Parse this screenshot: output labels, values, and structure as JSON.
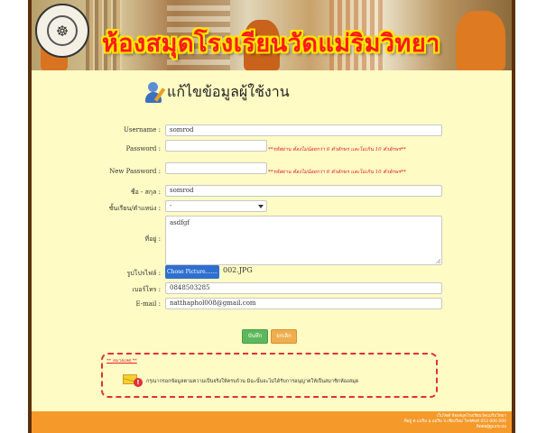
{
  "banner": {
    "title": "ห้องสมุดโรงเรียนวัดแม่ริมวิทยา"
  },
  "page": {
    "heading": "แก้ไขข้อมูลผู้ใช้งาน"
  },
  "form": {
    "username_label": "Username :",
    "username_value": "somrod",
    "password_label": "Password :",
    "password_value": "",
    "password_hint": "**รหัสผ่าน ต้องไม่น้อยกว่า 6 ตัวอักษร และไม่เกิน 10 ตัวอักษร**",
    "new_password_label": "New Password :",
    "new_password_value": "",
    "new_password_hint": "**รหัสผ่าน ต้องไม่น้อยกว่า 6 ตัวอักษร และไม่เกิน 10 ตัวอักษร**",
    "name_label": "ชื่อ - สกุล :",
    "name_value": "somrod",
    "class_label": "ชั้นเรียน/ตำแหน่ง :",
    "class_value": "-",
    "address_label": "ที่อยู่ :",
    "address_value": "asdfgf",
    "photo_label": "รูปโปรไฟล์ :",
    "photo_button": "Chose Picture.......",
    "photo_filename": "002.JPG",
    "phone_label": "เบอร์โทร :",
    "phone_value": "0848503285",
    "email_label": "E-mail :",
    "email_value": "natthaphol008@gmail.com",
    "save_button": "บันทึก",
    "cancel_button": "ยกเลิก"
  },
  "notice": {
    "label": "** หมายเหตุ **",
    "text": "กรุณากรอกข้อมูลตามความเป็นจริงให้ครบถ้วน มิฉะนั้นจะไม่ได้รับการอนุญาตให้เป็นสมาชิกห้องสมุด"
  },
  "footer": {
    "line1": "เว็บไซต์ ห้องสมุดโรงเรียนวัดแม่ริมวิทยา",
    "line2": "ที่อยู่ ต.แม่ริม อ.แม่ริม จ.เชียงใหม่ โทรศัพท์ 053 000 000",
    "line3": "ติดต่อผู้ดูแลระบบ"
  },
  "colors": {
    "accent_red": "#e0202a",
    "footer_orange": "#f59a2a",
    "page_bg": "#fffbc4",
    "frame_brown": "#5a300d"
  }
}
